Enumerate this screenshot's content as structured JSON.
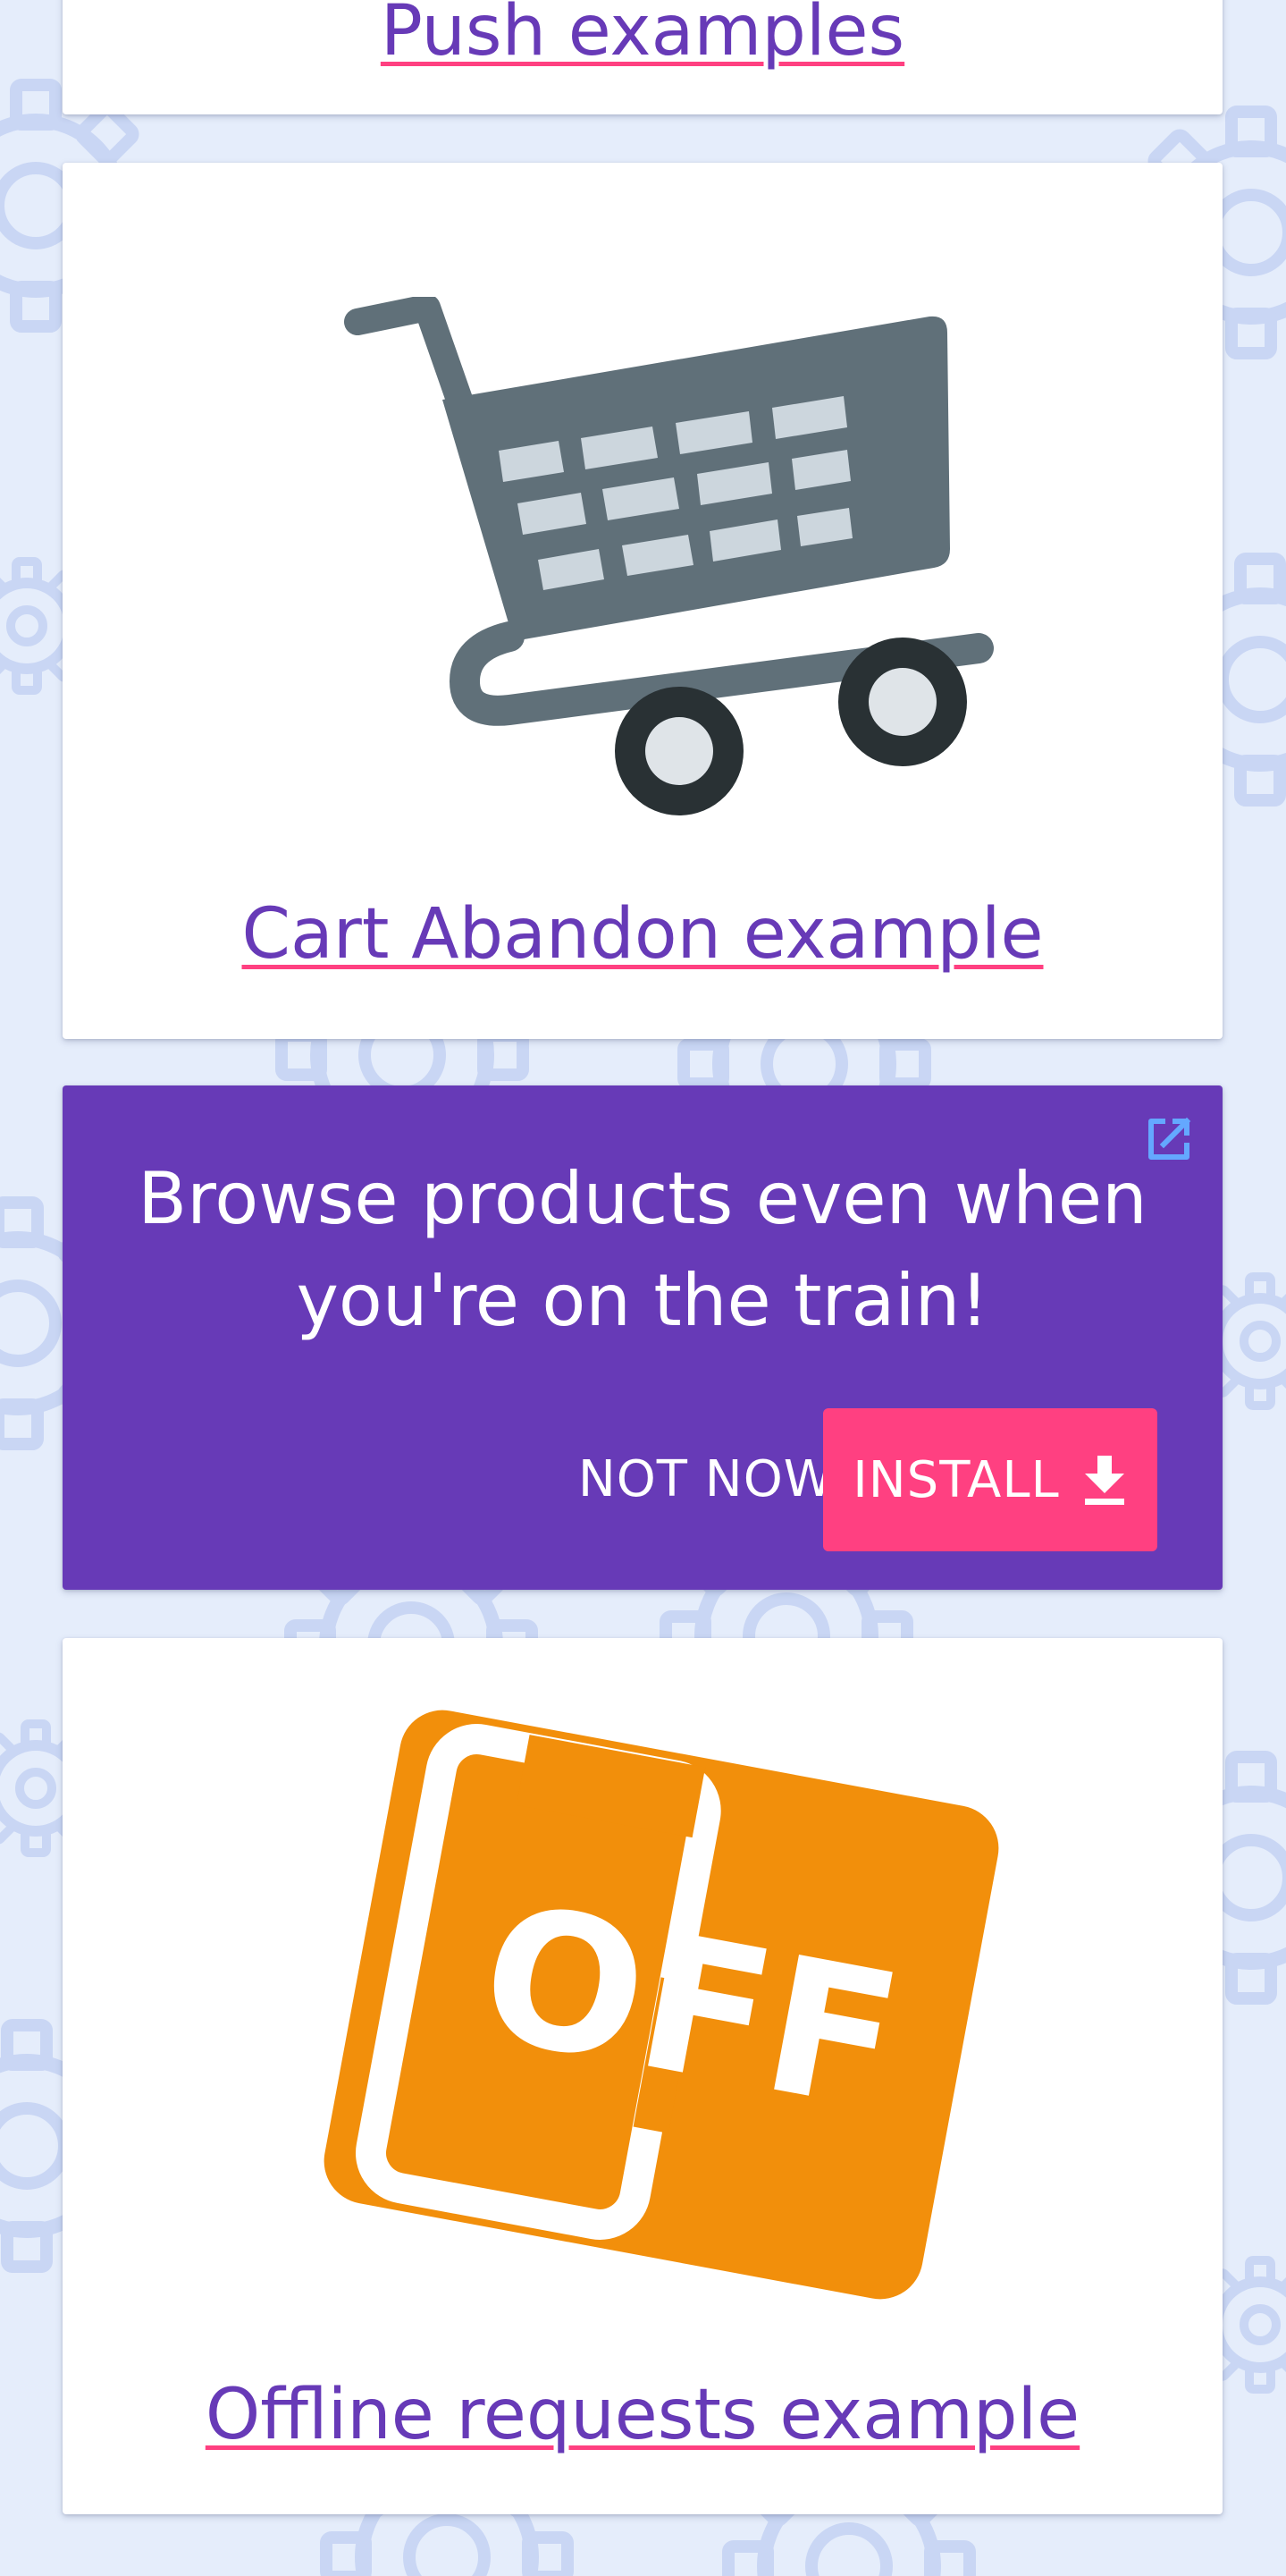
{
  "cards": {
    "push": {
      "link_label": "Push examples"
    },
    "cart_abandon": {
      "link_label": "Cart Abandon example",
      "icon": "shopping-cart-icon"
    },
    "offline": {
      "link_label": "Offline requests example",
      "icon": "offline-phone-icon",
      "icon_text": "OFF"
    }
  },
  "install_banner": {
    "message": "Browse products even when you're on the train!",
    "not_now_label": "NOT NOW",
    "install_label": "INSTALL",
    "install_icon": "download-icon",
    "external_icon": "open-in-new-icon"
  },
  "colors": {
    "background": "#e5edfb",
    "pattern": "#c8d5f4",
    "primary": "#673ab7",
    "accent": "#ff4081",
    "cart_body": "#607079",
    "cart_wheels": "#293134",
    "offline_orange": "#f28f0b"
  }
}
